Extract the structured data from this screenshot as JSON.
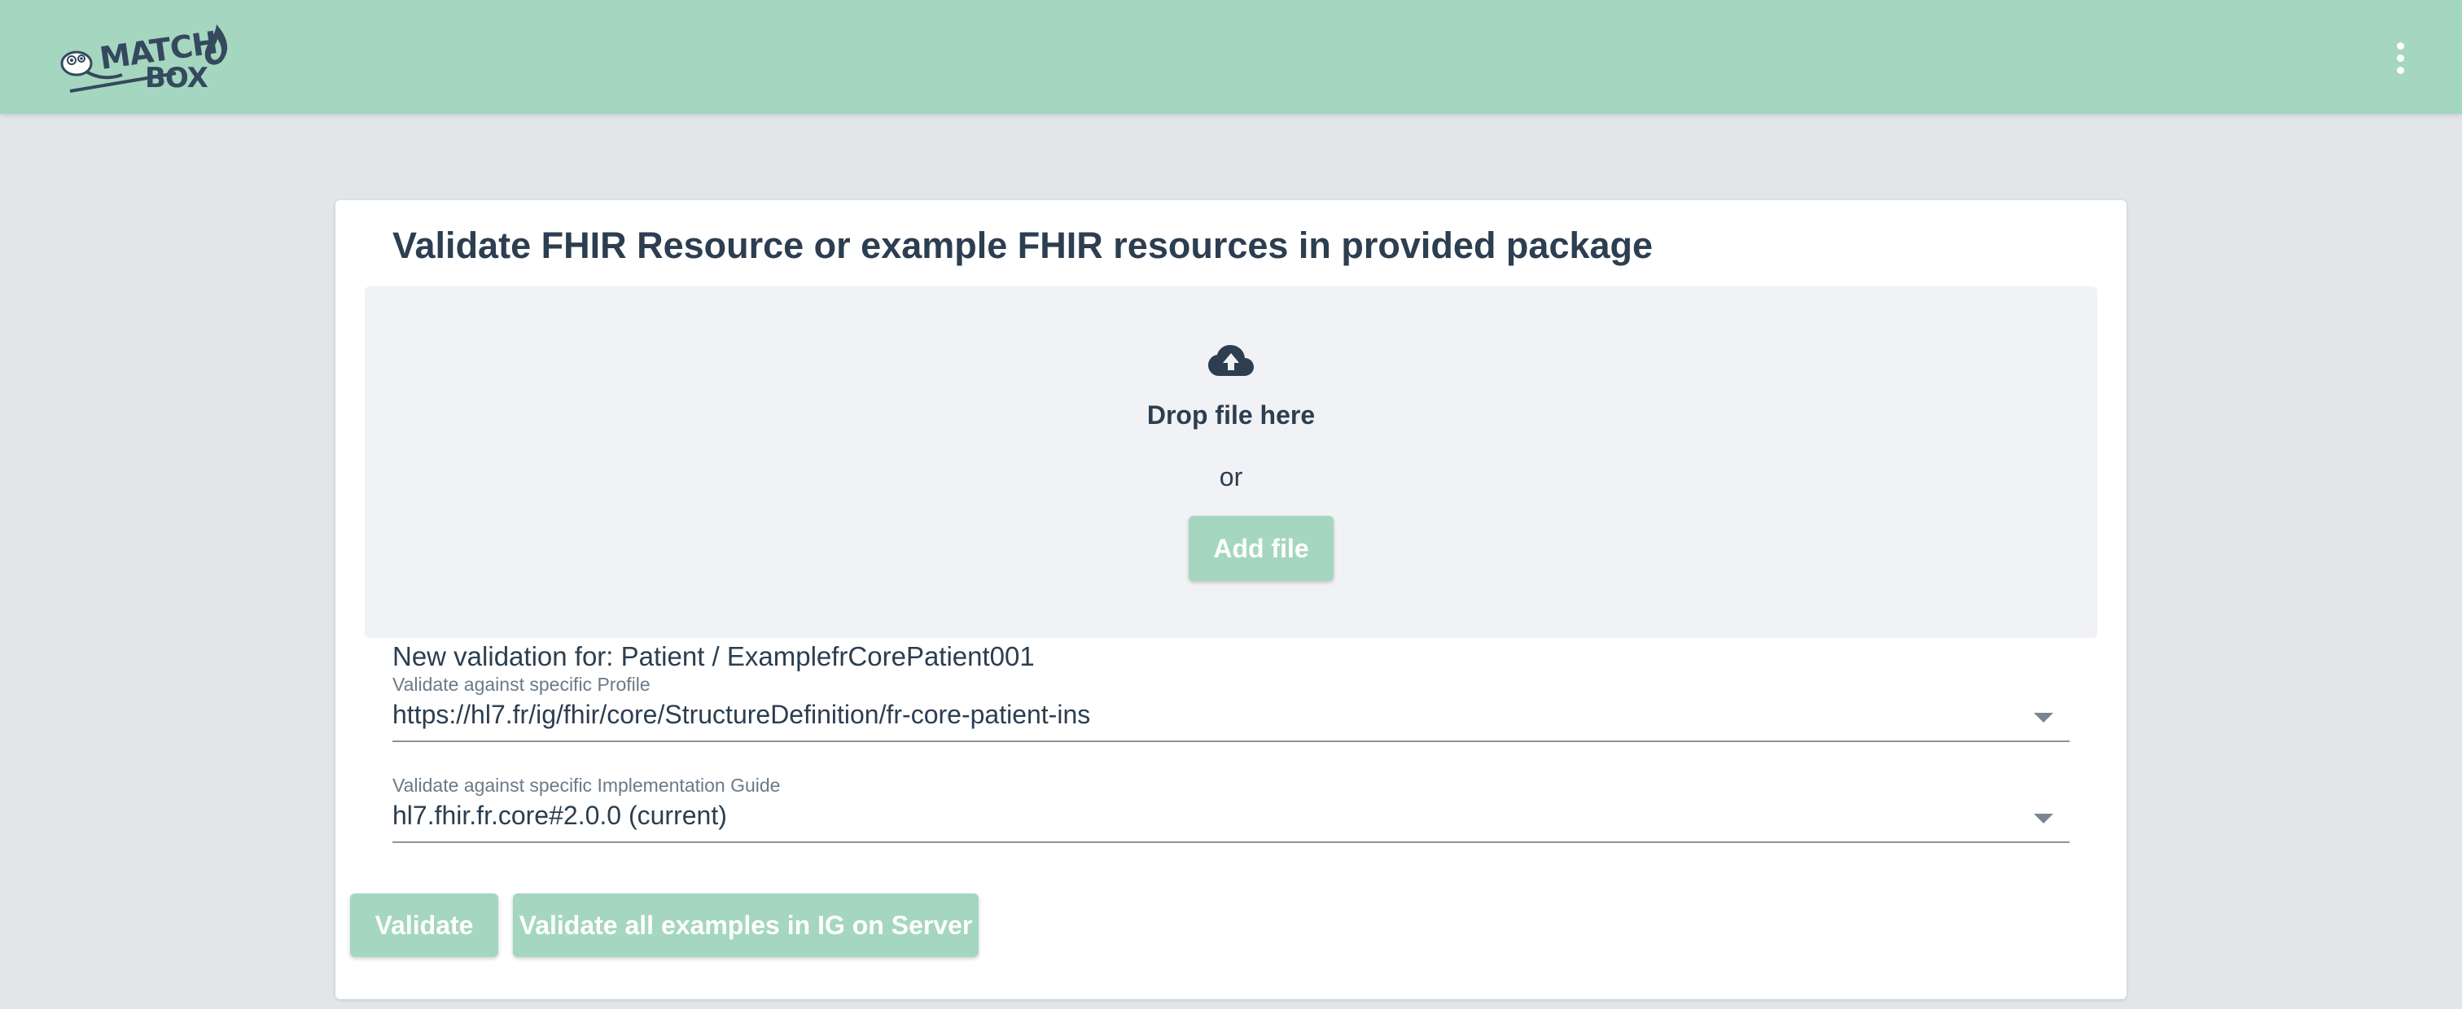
{
  "header": {
    "logo_text_top": "MATCH",
    "logo_text_bottom": "BOX",
    "menu_icon": "more-vertical-icon"
  },
  "colors": {
    "header_bg": "#a5d6bf",
    "page_bg": "#e3e6e9",
    "button_bg": "#a5d6bf",
    "text": "#2c3e50"
  },
  "main": {
    "title": "Validate FHIR Resource or example FHIR resources in provided package",
    "dropzone": {
      "icon": "cloud-upload-icon",
      "drop_text": "Drop file here",
      "or_text": "or",
      "add_file_label": "Add file"
    },
    "new_validation": "New validation for: Patient / ExamplefrCorePatient001",
    "profile": {
      "label": "Validate against specific Profile",
      "value": "https://hl7.fr/ig/fhir/core/StructureDefinition/fr-core-patient-ins"
    },
    "ig": {
      "label": "Validate against specific Implementation Guide",
      "value": "hl7.fhir.fr.core#2.0.0 (current)"
    },
    "buttons": {
      "validate": "Validate",
      "validate_all": "Validate all examples in IG on Server"
    }
  }
}
